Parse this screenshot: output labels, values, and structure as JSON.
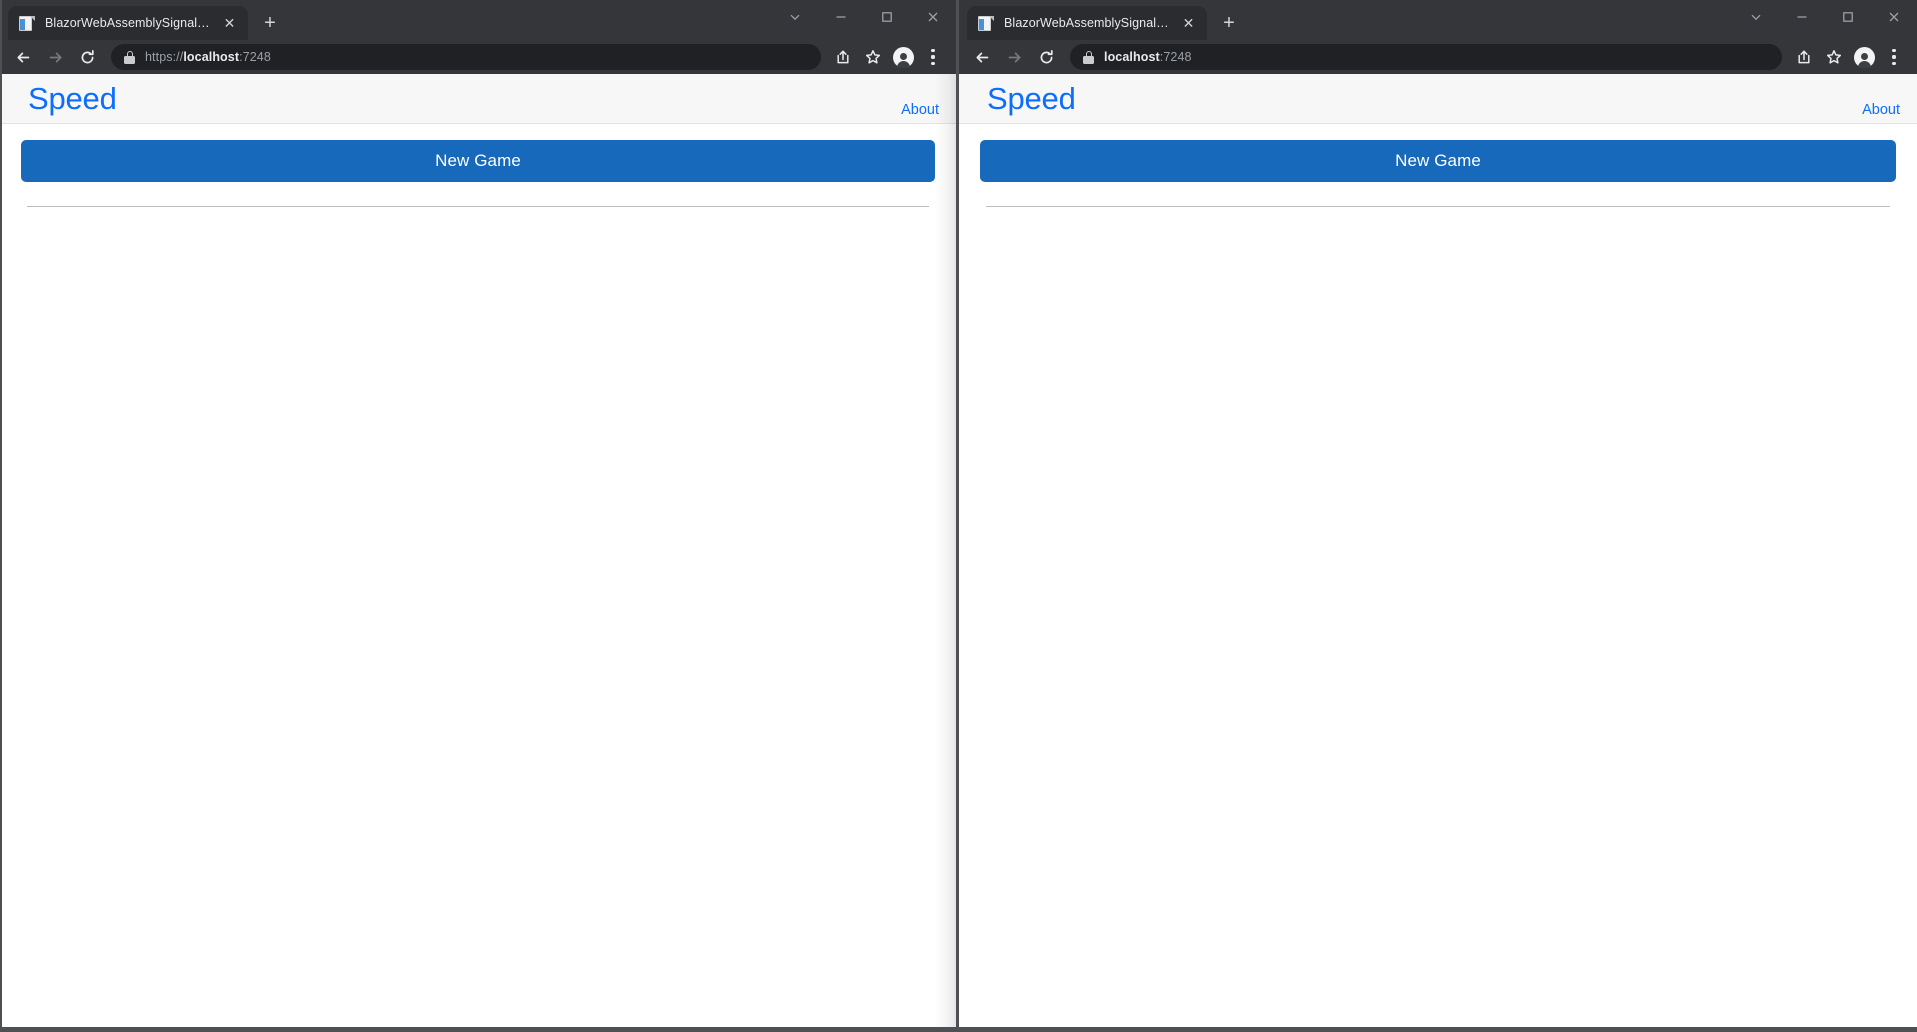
{
  "windows": [
    {
      "id": "left",
      "tab": {
        "title": "BlazorWebAssemblySignalRApp",
        "favicon": "document-icon",
        "close_label": "✕"
      },
      "newtab_label": "+",
      "window_controls": {
        "tab_search": "chevron-down-icon",
        "minimize": "minimize-icon",
        "maximize": "maximize-icon",
        "close": "close-icon"
      },
      "toolbar": {
        "back": "back-arrow-icon",
        "forward": "forward-arrow-icon",
        "reload": "reload-icon",
        "share": "share-icon",
        "bookmark": "star-icon",
        "profile": "avatar-icon",
        "menu": "kebab-menu-icon"
      },
      "omnibox": {
        "lock": "lock-icon",
        "scheme": "https://",
        "host": "localhost",
        "port": ":7248",
        "full_url": "https://localhost:7248"
      },
      "page": {
        "brand": "Speed",
        "about_link": "About",
        "new_game_button": "New Game"
      }
    },
    {
      "id": "right",
      "tab": {
        "title": "BlazorWebAssemblySignalRApp",
        "favicon": "document-icon",
        "close_label": "✕"
      },
      "newtab_label": "+",
      "window_controls": {
        "tab_search": "chevron-down-icon",
        "minimize": "minimize-icon",
        "maximize": "maximize-icon",
        "close": "close-icon"
      },
      "toolbar": {
        "back": "back-arrow-icon",
        "forward": "forward-arrow-icon",
        "reload": "reload-icon",
        "share": "share-icon",
        "bookmark": "star-icon",
        "profile": "avatar-icon",
        "menu": "kebab-menu-icon"
      },
      "omnibox": {
        "lock": "lock-icon",
        "scheme": "",
        "host": "localhost",
        "port": ":7248",
        "full_url": "localhost:7248"
      },
      "page": {
        "brand": "Speed",
        "about_link": "About",
        "new_game_button": "New Game"
      }
    }
  ],
  "colors": {
    "accent_blue": "#0d6efd",
    "button_blue": "#1769bb",
    "chrome_dark": "#35363a",
    "omnibox_dark": "#202124",
    "header_bg": "#f7f7f7"
  }
}
